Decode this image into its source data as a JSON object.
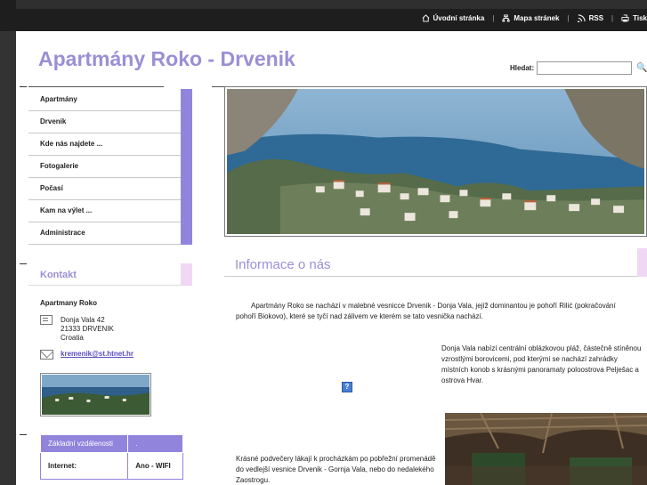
{
  "topnav": {
    "home": "Úvodní stránka",
    "sitemap": "Mapa stránek",
    "rss": "RSS",
    "print": "Tisk"
  },
  "site": {
    "title": "Apartmány Roko - Drvenik"
  },
  "search": {
    "label": "Hledat:",
    "value": ""
  },
  "menu": {
    "items": [
      {
        "label": "Apartmány"
      },
      {
        "label": "Drvenik"
      },
      {
        "label": "Kde nás najdete ..."
      },
      {
        "label": "Fotogalerie"
      },
      {
        "label": "Počasí"
      },
      {
        "label": "Kam na výlet ..."
      },
      {
        "label": "Administrace"
      }
    ]
  },
  "contact": {
    "heading": "Kontakt",
    "name": "Apartmany Roko",
    "address": [
      "Donja Vala 42",
      "21333 DRVENIK",
      "Croatia"
    ],
    "email": "kremenik@st.htnet.hr"
  },
  "distances": {
    "header": [
      "Základní vzdálenosti",
      "."
    ],
    "rows": [
      [
        "Internet:",
        "Ano - WIFI"
      ]
    ]
  },
  "main": {
    "heading": "Informace o nás",
    "para1": "Apartmány Roko se nachází v malebné vesnicce Drvenik - Donja Vala, jejíž dominantou je pohoří Rilić (pokračování pohoří Biokovo), které se tyčí nad zálivem ve kterém se tato vesnička nachází.",
    "para2": "Donja Vala nabízí centrální oblázkovou pláž, částečně stíněnou vzrostlými borovicemi, pod kterými se nachází zahrádky místních konob s krásnými panoramaty poloostrova Pelješac a ostrova Hvar.",
    "para3": "Krásné podvečery lákají k procházkám po pobřežní promenádě do vedlejší vesnice Drvenik - Gornja Vala, nebo do nedalekého Zaostrogu.",
    "help_icon": "?"
  },
  "colors": {
    "accent": "#9184dc",
    "title": "#9b8fd6",
    "pink": "#f0d7f4"
  }
}
